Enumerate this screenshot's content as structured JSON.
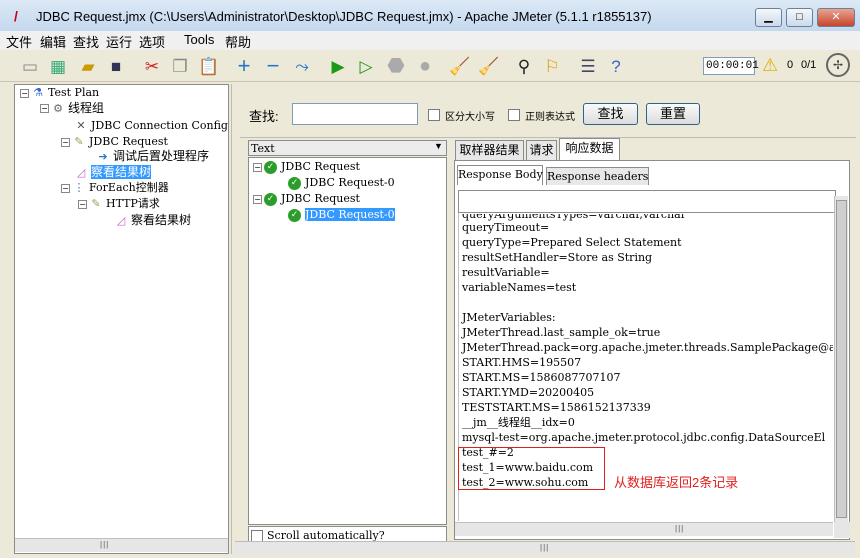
{
  "window": {
    "title": "JDBC Request.jmx (C:\\Users\\Administrator\\Desktop\\JDBC Request.jmx) - Apache JMeter (5.1.1 r1855137)",
    "minimize": "▁",
    "maximize": "□",
    "close": "✕"
  },
  "menu": [
    "文件",
    "编辑",
    "查找",
    "运行",
    "选项",
    "Tools",
    "帮助"
  ],
  "toolbar": {
    "timer": "00:00:01",
    "warn_count": "0",
    "threads": "0/1"
  },
  "left_tree": [
    {
      "label": "Test Plan",
      "icon": "flask-icon"
    },
    {
      "label": "线程组",
      "icon": "gear-icon"
    },
    {
      "label": "JDBC Connection Config",
      "icon": "wrench-icon"
    },
    {
      "label": "JDBC Request",
      "icon": "pencil-icon"
    },
    {
      "label": "调试后置处理程序",
      "icon": "arrow-icon"
    },
    {
      "label": "察看结果树",
      "icon": "chart-icon"
    },
    {
      "label": "ForEach控制器",
      "icon": "loop-icon"
    },
    {
      "label": "HTTP请求",
      "icon": "pencil-icon"
    },
    {
      "label": "察看结果树",
      "icon": "chart-icon"
    }
  ],
  "search": {
    "label": "查找:",
    "value": "",
    "case_label": "区分大小写",
    "regex_label": "正则表达式",
    "find_btn": "查找",
    "reset_btn": "重置"
  },
  "renderer": {
    "selected": "Text"
  },
  "result_tree": [
    {
      "label": "JDBC Request"
    },
    {
      "label": "JDBC Request-0"
    },
    {
      "label": "JDBC Request"
    },
    {
      "label": "JDBC Request-0"
    }
  ],
  "scroll_auto": "Scroll automatically?",
  "tabs": [
    "取样器结果",
    "请求",
    "响应数据"
  ],
  "subtabs": [
    "Response Body",
    "Response headers"
  ],
  "body_lines": [
    "queryTimeout=",
    "queryType=Prepared Select Statement",
    "resultSetHandler=Store as String",
    "resultVariable=",
    "variableNames=test",
    "",
    "JMeterVariables:",
    "JMeterThread.last_sample_ok=true",
    "JMeterThread.pack=org.apache.jmeter.threads.SamplePackage@abac",
    "START.HMS=195507",
    "START.MS=1586087707107",
    "START.YMD=20200405",
    "TESTSTART.MS=1586152137339",
    "__jm__线程组__idx=0",
    "mysql-test=org.apache.jmeter.protocol.jdbc.config.DataSourceEl",
    "test_#=2",
    "test_1=www.baidu.com",
    "test_2=www.sohu.com"
  ],
  "annotation": "从数据库返回2条记录"
}
